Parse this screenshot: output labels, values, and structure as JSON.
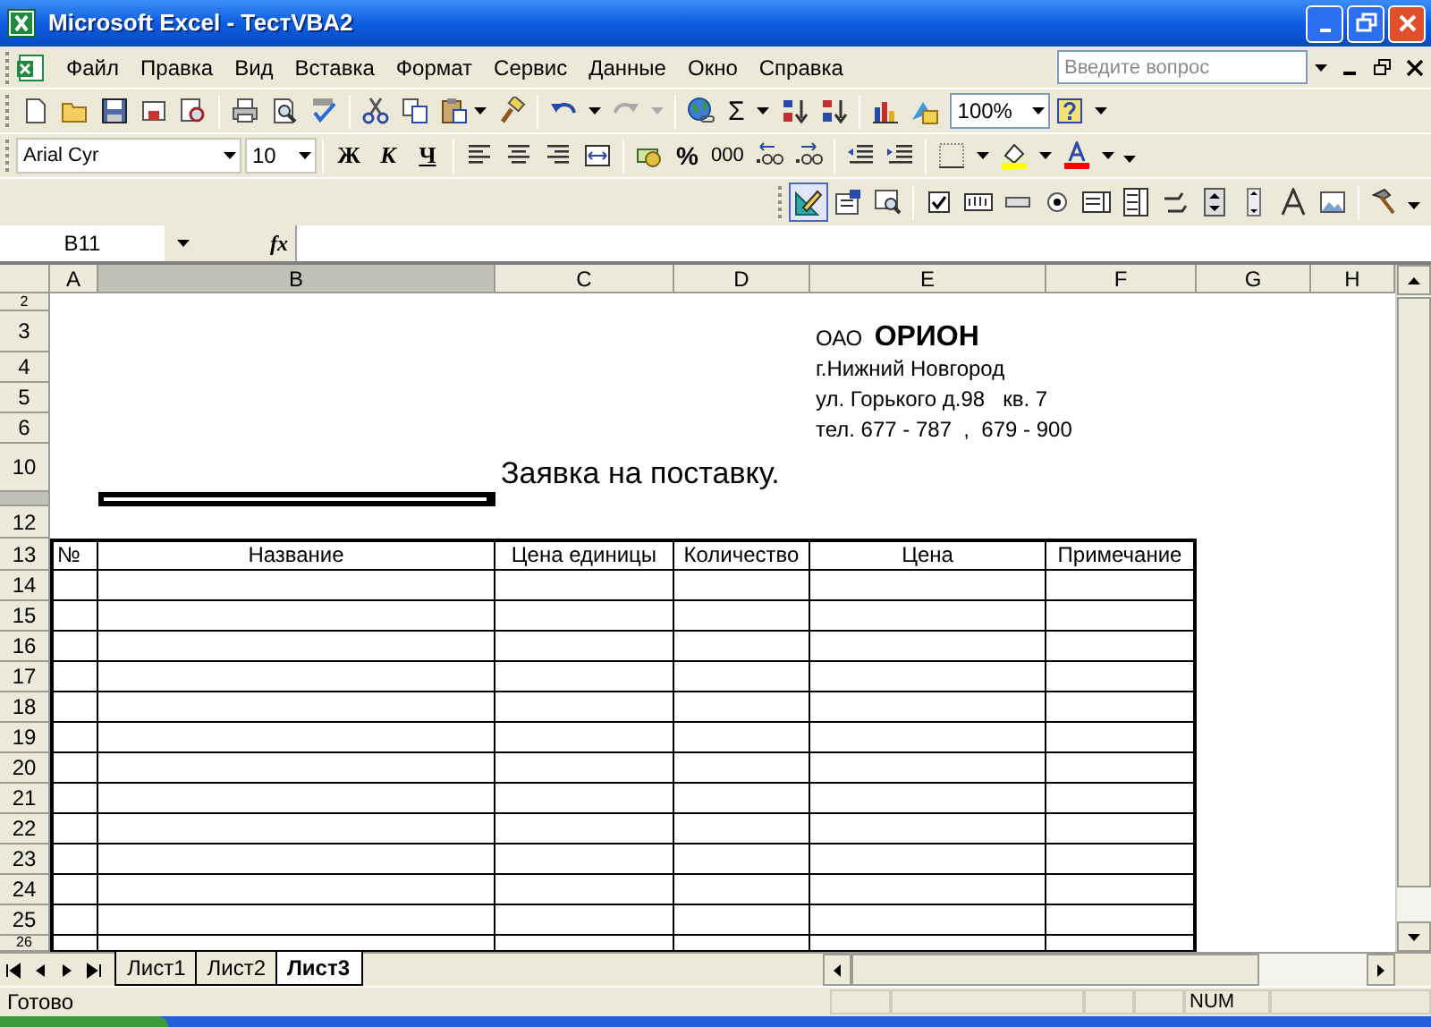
{
  "window": {
    "title": "Microsoft Excel - ТестVBA2"
  },
  "menu": [
    "Файл",
    "Правка",
    "Вид",
    "Вставка",
    "Формат",
    "Сервис",
    "Данные",
    "Окно",
    "Справка"
  ],
  "help_search": {
    "placeholder": "Введите вопрос"
  },
  "standard_toolbar": {
    "sum": "Σ",
    "zoom": "100%"
  },
  "formatting_toolbar": {
    "font": "Arial Cyr",
    "size": "10",
    "style_buttons": [
      "Ж",
      "К",
      "Ч"
    ],
    "percent": "%",
    "thousands": "000"
  },
  "formula_bar": {
    "name_box": "B11",
    "fx": "fx"
  },
  "columns": [
    {
      "label": "A",
      "selected": false
    },
    {
      "label": "B",
      "selected": true
    },
    {
      "label": "C",
      "selected": false
    },
    {
      "label": "D",
      "selected": false
    },
    {
      "label": "E",
      "selected": false
    },
    {
      "label": "F",
      "selected": false
    },
    {
      "label": "G",
      "selected": false
    },
    {
      "label": "H",
      "selected": false
    }
  ],
  "rows": [
    {
      "label": "2",
      "selected": false
    },
    {
      "label": "3",
      "selected": false
    },
    {
      "label": "4",
      "selected": false
    },
    {
      "label": "5",
      "selected": false
    },
    {
      "label": "6",
      "selected": false
    },
    {
      "label": "10",
      "selected": false
    },
    {
      "selected": true
    },
    {
      "label": "12",
      "selected": false
    },
    {
      "label": "13",
      "selected": false
    },
    {
      "label": "14",
      "selected": false
    },
    {
      "label": "15",
      "selected": false
    },
    {
      "label": "16",
      "selected": false
    },
    {
      "label": "17",
      "selected": false
    },
    {
      "label": "18",
      "selected": false
    },
    {
      "label": "19",
      "selected": false
    },
    {
      "label": "20",
      "selected": false
    },
    {
      "label": "21",
      "selected": false
    },
    {
      "label": "22",
      "selected": false
    },
    {
      "label": "23",
      "selected": false
    },
    {
      "label": "24",
      "selected": false
    },
    {
      "label": "25",
      "selected": false
    },
    {
      "label": "26",
      "selected": false
    }
  ],
  "company": {
    "name": "ОАО  **ОРИОН**",
    "lines": [
      "г.Нижний Новгород",
      "ул. Горького д.98   кв. 7",
      "тел. 677 - 787  ,  679 - 900"
    ]
  },
  "heading": "Заявка на поставку.",
  "table": {
    "header": [
      "№",
      "Название",
      "Цена единицы",
      "Количество",
      "Цена",
      "Примечание"
    ]
  },
  "sheet_tabs": [
    {
      "label": "Лист1",
      "selected": false
    },
    {
      "label": "Лист2",
      "selected": false
    },
    {
      "label": "Лист3",
      "selected": true
    }
  ],
  "status_bar": {
    "text": "Готово",
    "indicator": "NUM"
  }
}
